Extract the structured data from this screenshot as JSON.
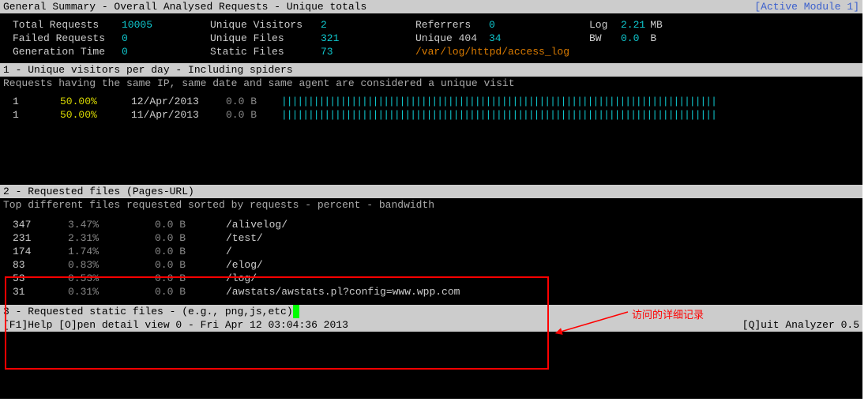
{
  "header": {
    "title": "General Summary - Overall Analysed Requests - Unique totals",
    "module": "[Active Module 1]"
  },
  "summary": {
    "total_requests_label": "Total Requests",
    "total_requests": "10005",
    "unique_visitors_label": "Unique Visitors",
    "unique_visitors": "2",
    "referrers_label": "Referrers",
    "referrers": "0",
    "log_label": "Log",
    "log_size": "2.21",
    "log_unit": "MB",
    "failed_label": "Failed Requests",
    "failed": "0",
    "unique_files_label": "Unique Files",
    "unique_files": "321",
    "unique_404_label": "Unique 404",
    "unique_404": "34",
    "bw_label": "BW",
    "bw": "0.0",
    "bw_unit": "B",
    "gen_label": "Generation Time",
    "gen": "0",
    "static_files_label": "Static Files",
    "static_files": "73",
    "log_path": "/var/log/httpd/access_log"
  },
  "section1": {
    "title": " 1 - Unique visitors per day - Including spiders",
    "subtitle": "Requests having the same IP, same date and same agent are considered a unique visit",
    "rows": [
      {
        "count": "1",
        "pct": "50.00%",
        "date": "12/Apr/2013",
        "bw": "0.0  B"
      },
      {
        "count": "1",
        "pct": "50.00%",
        "date": "11/Apr/2013",
        "bw": "0.0  B"
      }
    ],
    "bar": "|||||||||||||||||||||||||||||||||||||||||||||||||||||||||||||||||||||||||||||||||"
  },
  "section2": {
    "title": " 2 - Requested files (Pages-URL)",
    "subtitle": "Top different files requested sorted by requests - percent - bandwidth",
    "rows": [
      {
        "count": "347",
        "pct": "3.47%",
        "bw": "0.0  B",
        "path": "/alivelog/"
      },
      {
        "count": "231",
        "pct": "2.31%",
        "bw": "0.0  B",
        "path": "/test/"
      },
      {
        "count": "174",
        "pct": "1.74%",
        "bw": "0.0  B",
        "path": "/"
      },
      {
        "count": "83",
        "pct": "0.83%",
        "bw": "0.0  B",
        "path": "/elog/"
      },
      {
        "count": "53",
        "pct": "0.53%",
        "bw": "0.0  B",
        "path": "/log/"
      },
      {
        "count": "31",
        "pct": "0.31%",
        "bw": "0.0  B",
        "path": "/awstats/awstats.pl?config=www.wpp.com"
      }
    ]
  },
  "section3": {
    "title": " 3 - Requested static files - (e.g., png,js,etc)"
  },
  "footer": {
    "left": "[F1]Help [O]pen detail view  0 - Fri Apr 12 03:04:36 2013",
    "right": "[Q]uit Analyzer 0.5"
  },
  "annotation": {
    "text": "访问的详细记录"
  }
}
